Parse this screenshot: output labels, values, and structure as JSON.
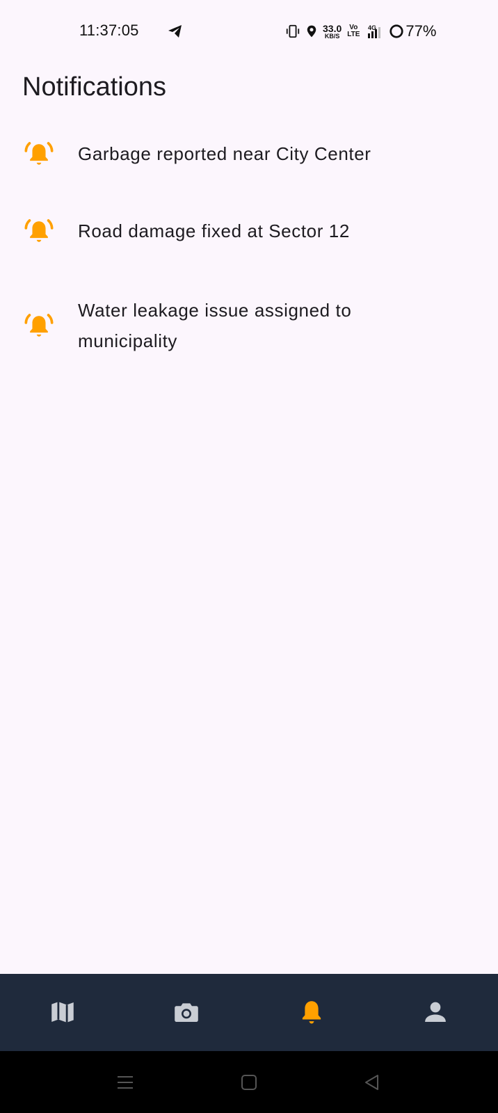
{
  "status_bar": {
    "time": "11:37:05",
    "net_speed_value": "33.0",
    "net_speed_unit": "KB/S",
    "volte_top": "Vo",
    "volte_bottom": "LTE",
    "network": "4G",
    "battery": "77%"
  },
  "header": {
    "title": "Notifications"
  },
  "notifications": [
    {
      "text": "Garbage reported near City Center",
      "icon": "bell-ring-icon"
    },
    {
      "text": "Road damage fixed at Sector 12",
      "icon": "bell-ring-icon"
    },
    {
      "text": "Water leakage issue assigned to municipality",
      "icon": "bell-ring-icon"
    }
  ],
  "bottom_nav": {
    "items": [
      {
        "icon": "map-icon",
        "active": false
      },
      {
        "icon": "camera-icon",
        "active": false
      },
      {
        "icon": "bell-icon",
        "active": true
      },
      {
        "icon": "person-icon",
        "active": false
      }
    ]
  },
  "colors": {
    "background": "#fcf6fd",
    "accent": "#ffa000",
    "nav_background": "#1f2a3c",
    "nav_inactive": "#c9cdd4"
  }
}
